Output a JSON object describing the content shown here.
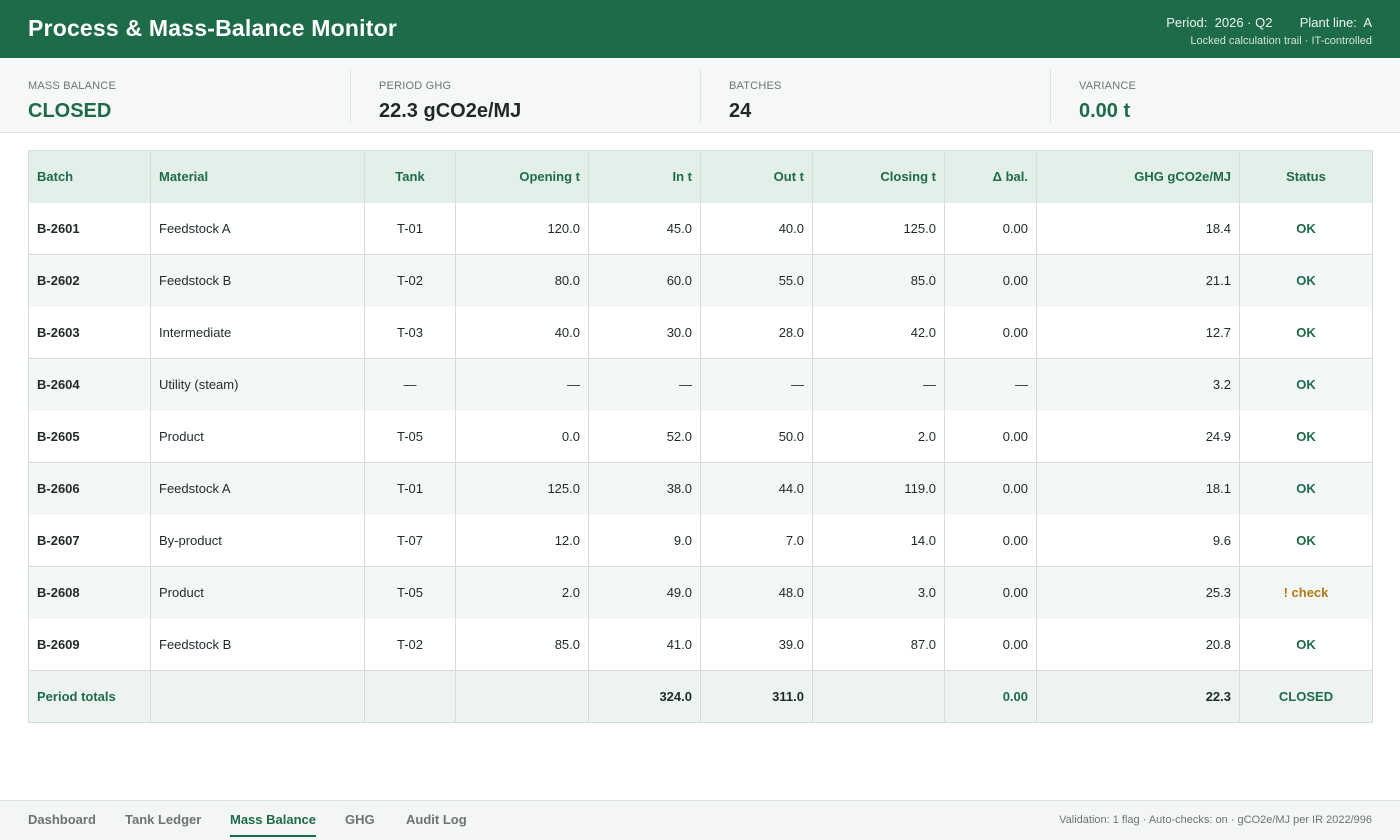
{
  "header": {
    "title": "Process & Mass-Balance Monitor",
    "period_label": "Period:",
    "period_value": "2026 · Q2",
    "plant_label": "Plant line:",
    "plant_value": "A",
    "subline": "Locked calculation trail · IT-controlled"
  },
  "kpis": [
    {
      "label": "MASS BALANCE",
      "value": "CLOSED"
    },
    {
      "label": "PERIOD GHG",
      "value": "22.3 gCO2e/MJ"
    },
    {
      "label": "BATCHES",
      "value": "24"
    },
    {
      "label": "VARIANCE",
      "value": "0.00 t"
    }
  ],
  "table": {
    "columns": [
      "Batch",
      "Material",
      "Tank",
      "Opening t",
      "In t",
      "Out t",
      "Closing t",
      "Δ bal.",
      "GHG gCO2e/MJ",
      "Status"
    ],
    "rows": [
      {
        "batch": "B-2601",
        "material": "Feedstock A",
        "tank": "T-01",
        "opening": "120.0",
        "in": "45.0",
        "out": "40.0",
        "closing": "125.0",
        "delta": "0.00",
        "ghg": "18.4",
        "status": "OK"
      },
      {
        "batch": "B-2602",
        "material": "Feedstock B",
        "tank": "T-02",
        "opening": "80.0",
        "in": "60.0",
        "out": "55.0",
        "closing": "85.0",
        "delta": "0.00",
        "ghg": "21.1",
        "status": "OK"
      },
      {
        "batch": "B-2603",
        "material": "Intermediate",
        "tank": "T-03",
        "opening": "40.0",
        "in": "30.0",
        "out": "28.0",
        "closing": "42.0",
        "delta": "0.00",
        "ghg": "12.7",
        "status": "OK"
      },
      {
        "batch": "B-2604",
        "material": "Utility (steam)",
        "tank": "—",
        "opening": "—",
        "in": "—",
        "out": "—",
        "closing": "—",
        "delta": "—",
        "ghg": "3.2",
        "status": "OK"
      },
      {
        "batch": "B-2605",
        "material": "Product",
        "tank": "T-05",
        "opening": "0.0",
        "in": "52.0",
        "out": "50.0",
        "closing": "2.0",
        "delta": "0.00",
        "ghg": "24.9",
        "status": "OK"
      },
      {
        "batch": "B-2606",
        "material": "Feedstock A",
        "tank": "T-01",
        "opening": "125.0",
        "in": "38.0",
        "out": "44.0",
        "closing": "119.0",
        "delta": "0.00",
        "ghg": "18.1",
        "status": "OK"
      },
      {
        "batch": "B-2607",
        "material": "By-product",
        "tank": "T-07",
        "opening": "12.0",
        "in": "9.0",
        "out": "7.0",
        "closing": "14.0",
        "delta": "0.00",
        "ghg": "9.6",
        "status": "OK"
      },
      {
        "batch": "B-2608",
        "material": "Product",
        "tank": "T-05",
        "opening": "2.0",
        "in": "49.0",
        "out": "48.0",
        "closing": "3.0",
        "delta": "0.00",
        "ghg": "25.3",
        "status": "! check"
      },
      {
        "batch": "B-2609",
        "material": "Feedstock B",
        "tank": "T-02",
        "opening": "85.0",
        "in": "41.0",
        "out": "39.0",
        "closing": "87.0",
        "delta": "0.00",
        "ghg": "20.8",
        "status": "OK"
      }
    ],
    "totals": {
      "label": "Period totals",
      "in": "324.0",
      "out": "311.0",
      "delta": "0.00",
      "ghg": "22.3",
      "status": "CLOSED"
    }
  },
  "tabs": [
    {
      "label": "Dashboard",
      "active": false
    },
    {
      "label": "Tank Ledger",
      "active": false
    },
    {
      "label": "Mass Balance",
      "active": true
    },
    {
      "label": "GHG",
      "active": false
    },
    {
      "label": "Audit Log",
      "active": false
    }
  ],
  "footer_status": "Validation: 1 flag · Auto-checks: on · gCO2e/MJ per IR 2022/996",
  "colors": {
    "brand": "#1e6b4a",
    "warning": "#b27a12"
  }
}
